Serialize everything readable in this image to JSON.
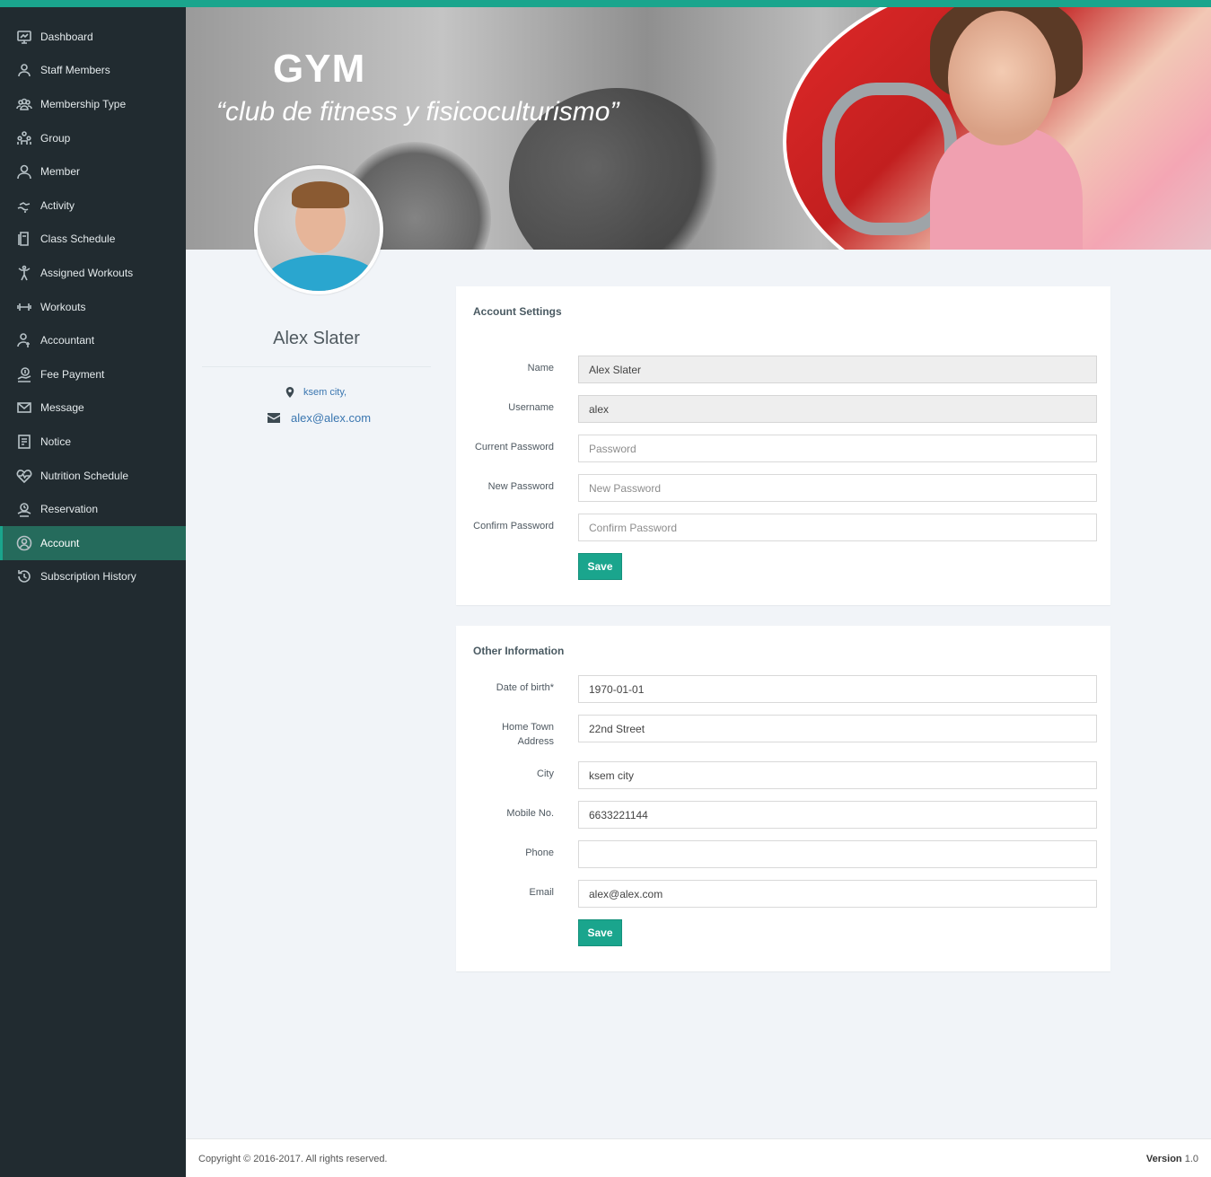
{
  "sidebar": {
    "items": [
      {
        "label": "Dashboard",
        "icon": "dashboard-icon"
      },
      {
        "label": "Staff Members",
        "icon": "staff-icon"
      },
      {
        "label": "Membership Type",
        "icon": "membership-icon"
      },
      {
        "label": "Group",
        "icon": "group-icon"
      },
      {
        "label": "Member",
        "icon": "member-icon"
      },
      {
        "label": "Activity",
        "icon": "activity-icon"
      },
      {
        "label": "Class Schedule",
        "icon": "class-schedule-icon"
      },
      {
        "label": "Assigned Workouts",
        "icon": "assigned-workouts-icon"
      },
      {
        "label": "Workouts",
        "icon": "dumbbell-icon"
      },
      {
        "label": "Accountant",
        "icon": "accountant-icon"
      },
      {
        "label": "Fee Payment",
        "icon": "fee-payment-icon"
      },
      {
        "label": "Message",
        "icon": "envelope-icon"
      },
      {
        "label": "Notice",
        "icon": "notice-icon"
      },
      {
        "label": "Nutrition Schedule",
        "icon": "heartbeat-icon"
      },
      {
        "label": "Reservation",
        "icon": "reservation-icon"
      },
      {
        "label": "Account",
        "icon": "account-icon",
        "active": true
      },
      {
        "label": "Subscription History",
        "icon": "history-icon"
      }
    ]
  },
  "banner": {
    "title": "GYM",
    "subtitle": "“club de fitness y fisicoculturismo”"
  },
  "profile": {
    "name": "Alex Slater",
    "city": "ksem city,",
    "email": "alex@alex.com"
  },
  "account_settings": {
    "title": "Account Settings",
    "fields": {
      "name": {
        "label": "Name",
        "value": "Alex Slater"
      },
      "username": {
        "label": "Username",
        "value": "alex"
      },
      "current_password": {
        "label": "Current Password",
        "placeholder": "Password"
      },
      "new_password": {
        "label": "New Password",
        "placeholder": "New Password"
      },
      "confirm_password": {
        "label": "Confirm Password",
        "placeholder": "Confirm Password"
      }
    },
    "save_label": "Save"
  },
  "other_information": {
    "title": "Other Information",
    "fields": {
      "dob": {
        "label": "Date of birth*",
        "value": "1970-01-01"
      },
      "address": {
        "label": "Home Town Address",
        "value": "22nd Street"
      },
      "city": {
        "label": "City",
        "value": "ksem city"
      },
      "mobile": {
        "label": "Mobile No.",
        "value": "6633221144"
      },
      "phone": {
        "label": "Phone",
        "value": ""
      },
      "email": {
        "label": "Email",
        "value": "alex@alex.com"
      }
    },
    "save_label": "Save"
  },
  "footer": {
    "copyright": "Copyright © 2016-2017. All rights reserved.",
    "version_label": "Version",
    "version_number": "1.0"
  },
  "colors": {
    "accent": "#1aa58d",
    "sidebar_bg": "#212b30",
    "sidebar_active": "#256b5c",
    "link": "#3a76b0",
    "page_bg": "#f1f4f8"
  }
}
